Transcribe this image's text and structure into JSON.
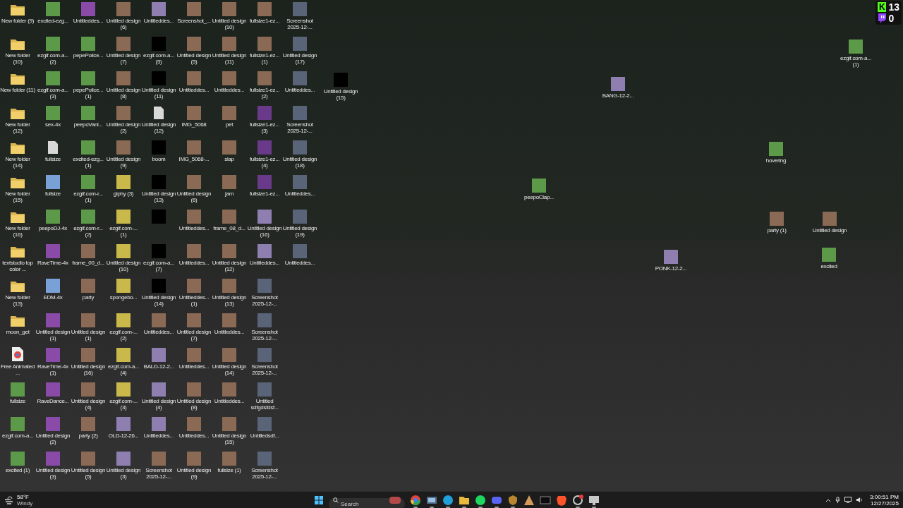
{
  "desktop": {
    "columns": [
      [
        {
          "label": "New folder (9)",
          "kind": "folder"
        },
        {
          "label": "New folder (10)",
          "kind": "folder"
        },
        {
          "label": "New folder (11)",
          "kind": "folder"
        },
        {
          "label": "New folder (12)",
          "kind": "folder"
        },
        {
          "label": "New folder (14)",
          "kind": "folder"
        },
        {
          "label": "New folder (15)",
          "kind": "folder"
        },
        {
          "label": "New folder (16)",
          "kind": "folder"
        },
        {
          "label": "textstudio top color ...",
          "kind": "folder"
        },
        {
          "label": "New folder (13)",
          "kind": "folder"
        },
        {
          "label": "moon_get",
          "kind": "folder"
        },
        {
          "label": "Free Animated ...",
          "kind": "browser"
        },
        {
          "label": "fullsize",
          "kind": "frog"
        },
        {
          "label": "ezgif.com-a...",
          "kind": "frog"
        },
        {
          "label": "excited (1)",
          "kind": "frog"
        }
      ],
      [
        {
          "label": "excited-ezg...",
          "kind": "frog"
        },
        {
          "label": "ezgif.com-a... (2)",
          "kind": "frog"
        },
        {
          "label": "ezgif.com-a... (3)",
          "kind": "frog"
        },
        {
          "label": "sex-4x",
          "kind": "frog"
        },
        {
          "label": "fullsize",
          "kind": "blank"
        },
        {
          "label": "fullsize",
          "kind": "equalizer"
        },
        {
          "label": "peepoDJ-4x",
          "kind": "frog"
        },
        {
          "label": "RaveTime-4x",
          "kind": "rave"
        },
        {
          "label": "EDM-4x",
          "kind": "equalizer"
        },
        {
          "label": "Untitled design (1)",
          "kind": "rave"
        },
        {
          "label": "RaveTime-4x (1)",
          "kind": "rave"
        },
        {
          "label": "RaveDance...",
          "kind": "rave"
        },
        {
          "label": "Untitled design (2)",
          "kind": "rave"
        },
        {
          "label": "Untitled design (3)",
          "kind": "rave"
        }
      ],
      [
        {
          "label": "Untitleddes...",
          "kind": "rave"
        },
        {
          "label": "pepePolice...",
          "kind": "frog"
        },
        {
          "label": "pepePolice... (1)",
          "kind": "frog"
        },
        {
          "label": "peepoVanl...",
          "kind": "frog"
        },
        {
          "label": "excited-ezg... (1)",
          "kind": "frog"
        },
        {
          "label": "ezgif.com-r... (1)",
          "kind": "frog"
        },
        {
          "label": "ezgif.com-r... (2)",
          "kind": "frog"
        },
        {
          "label": "frame_00_d...",
          "kind": "face"
        },
        {
          "label": "party",
          "kind": "face"
        },
        {
          "label": "Untitled design (1)",
          "kind": "face"
        },
        {
          "label": "Untitled design (16)",
          "kind": "face"
        },
        {
          "label": "Untitled design (4)",
          "kind": "face"
        },
        {
          "label": "party (2)",
          "kind": "face"
        },
        {
          "label": "Untitled design (5)",
          "kind": "face"
        }
      ],
      [
        {
          "label": "Untitled design (6)",
          "kind": "face"
        },
        {
          "label": "Untitled design (7)",
          "kind": "face"
        },
        {
          "label": "Untitled design (8)",
          "kind": "face"
        },
        {
          "label": "Untitled design (2)",
          "kind": "face"
        },
        {
          "label": "Untitled design (9)",
          "kind": "face"
        },
        {
          "label": "giphy (3)",
          "kind": "sponge"
        },
        {
          "label": "ezgif.com-... (1)",
          "kind": "sponge"
        },
        {
          "label": "Untitled design (10)",
          "kind": "sponge"
        },
        {
          "label": "spongebo...",
          "kind": "sponge"
        },
        {
          "label": "ezgif.com-... (2)",
          "kind": "sponge"
        },
        {
          "label": "ezgif.com-a... (4)",
          "kind": "sponge"
        },
        {
          "label": "ezgif.com-... (3)",
          "kind": "sponge"
        },
        {
          "label": "OLD-12-26...",
          "kind": "lettering"
        },
        {
          "label": "Untitled design (3)",
          "kind": "lettering"
        }
      ],
      [
        {
          "label": "Untitleddes...",
          "kind": "lettering"
        },
        {
          "label": "ezgif.com-a... (5)",
          "kind": "black"
        },
        {
          "label": "Untitled design (11)",
          "kind": "black"
        },
        {
          "label": "Untitled design (12)",
          "kind": "blank"
        },
        {
          "label": "boom",
          "kind": "black"
        },
        {
          "label": "Untitled design (13)",
          "kind": "black"
        },
        {
          "kind": "black"
        },
        {
          "label": "ezgif.com-a... (7)",
          "kind": "black"
        },
        {
          "label": "Untitled design (14)",
          "kind": "black"
        },
        {
          "label": "Untitleddes...",
          "kind": "face"
        },
        {
          "label": "BALD-12-2...",
          "kind": "lettering"
        },
        {
          "label": "Untitled design (4)",
          "kind": "lettering"
        },
        {
          "label": "Untitleddes...",
          "kind": "lettering"
        },
        {
          "label": "Screenshot 2025-12-...",
          "kind": "face"
        }
      ],
      [
        {
          "label": "Screenshot_...",
          "kind": "face"
        },
        {
          "label": "Untitled design (5)",
          "kind": "face"
        },
        {
          "label": "Untitleddes...",
          "kind": "face"
        },
        {
          "label": "IMG_5068",
          "kind": "face"
        },
        {
          "label": "IMG_5068-...",
          "kind": "face"
        },
        {
          "label": "Untitled design (6)",
          "kind": "face"
        },
        {
          "label": "Untitleddes...",
          "kind": "face"
        },
        {
          "label": "Untitleddes...",
          "kind": "face"
        },
        {
          "label": "Untitleddes... (1)",
          "kind": "face"
        },
        {
          "label": "Untitled design (7)",
          "kind": "face"
        },
        {
          "label": "Untitleddes...",
          "kind": "face"
        },
        {
          "label": "Untitled design (8)",
          "kind": "face"
        },
        {
          "label": "Untitleddes...",
          "kind": "face"
        },
        {
          "label": "Untitled design (9)",
          "kind": "face"
        }
      ],
      [
        {
          "label": "Untitled design (10)",
          "kind": "face"
        },
        {
          "label": "Untitled design (11)",
          "kind": "face"
        },
        {
          "label": "Untitleddes...",
          "kind": "face"
        },
        {
          "label": "pet",
          "kind": "face"
        },
        {
          "label": "slap",
          "kind": "face"
        },
        {
          "label": "jam",
          "kind": "face"
        },
        {
          "label": "frame_08_d...",
          "kind": "face"
        },
        {
          "label": "Untitled design (12)",
          "kind": "face"
        },
        {
          "label": "Untitled design (13)",
          "kind": "face"
        },
        {
          "label": "Untitleddes...",
          "kind": "face"
        },
        {
          "label": "Untitled design (14)",
          "kind": "face"
        },
        {
          "label": "Untitleddes...",
          "kind": "face"
        },
        {
          "label": "Untitled design (15)",
          "kind": "face"
        },
        {
          "label": "fullsize (1)",
          "kind": "face"
        }
      ],
      [
        {
          "label": "fullsize1-ez...",
          "kind": "face"
        },
        {
          "label": "fullsize1-ez... (1)",
          "kind": "face"
        },
        {
          "label": "fullsize1-ez... (2)",
          "kind": "face"
        },
        {
          "label": "fullsize1-ez... (3)",
          "kind": "villain"
        },
        {
          "label": "fullsize1-ez... (4)",
          "kind": "villain"
        },
        {
          "label": "fullsize1-ez...",
          "kind": "villain"
        },
        {
          "label": "Untitled design (16)",
          "kind": "lettering"
        },
        {
          "label": "Untitleddes...",
          "kind": "lettering"
        },
        {
          "label": "Screenshot 2025-12-...",
          "kind": "screenshot"
        },
        {
          "label": "Screenshot 2025-12-...",
          "kind": "screenshot"
        },
        {
          "label": "Screenshot 2025-12-...",
          "kind": "screenshot"
        },
        {
          "label": "Untitled sdfgdsfdsf...",
          "kind": "screenshot"
        },
        {
          "label": "Untitledsdf...",
          "kind": "screenshot"
        },
        {
          "label": "Screenshot 2025-12-...",
          "kind": "screenshot"
        }
      ],
      [
        {
          "label": "Screenshot 2025-12-...",
          "kind": "screenshot"
        },
        {
          "label": "Untitled design (17)",
          "kind": "screenshot"
        },
        {
          "label": "Untitleddes...",
          "kind": "screenshot"
        },
        {
          "label": "Screenshot 2025-12-...",
          "kind": "screenshot"
        },
        {
          "label": "Untitled design (18)",
          "kind": "screenshot"
        },
        {
          "label": "Untitleddes...",
          "kind": "screenshot"
        },
        {
          "label": "Untitled design (19)",
          "kind": "screenshot"
        },
        {
          "label": "Untitleddes...",
          "kind": "screenshot"
        }
      ]
    ],
    "loose_icons": [
      {
        "label": "Untitled design (15)",
        "kind": "black"
      },
      {
        "label": "BANG-12-2...",
        "kind": "lettering"
      },
      {
        "label": "peepoClap...",
        "kind": "frog"
      },
      {
        "label": "PONK-12-2...",
        "kind": "lettering"
      },
      {
        "label": "ezgif.com-a... (1)",
        "kind": "frog"
      },
      {
        "label": "hovering",
        "kind": "frog"
      },
      {
        "label": "party (1)",
        "kind": "face"
      },
      {
        "label": "Untitled design",
        "kind": "face"
      },
      {
        "label": "excited",
        "kind": "frog"
      }
    ]
  },
  "overlay": {
    "kick_letter": "K",
    "kick_count": "13",
    "twitch_count": "0"
  },
  "taskbar": {
    "weather": {
      "temperature": "58°F",
      "condition": "Windy"
    },
    "search": {
      "placeholder": "Search"
    },
    "apps": [
      {
        "kind": "chrome",
        "running": true
      },
      {
        "kind": "taskview",
        "running": true
      },
      {
        "kind": "edge",
        "running": true
      },
      {
        "kind": "explorer",
        "running": true
      },
      {
        "kind": "spotify",
        "running": true
      },
      {
        "kind": "discord",
        "running": true
      },
      {
        "kind": "shield",
        "running": true
      },
      {
        "kind": "tent",
        "running": false
      },
      {
        "kind": "terminal",
        "running": false
      },
      {
        "kind": "brave",
        "running": false
      },
      {
        "kind": "notify",
        "running": true
      },
      {
        "kind": "monitor",
        "running": true
      }
    ],
    "time": "3:00:51 PM",
    "date": "12/27/2025"
  }
}
